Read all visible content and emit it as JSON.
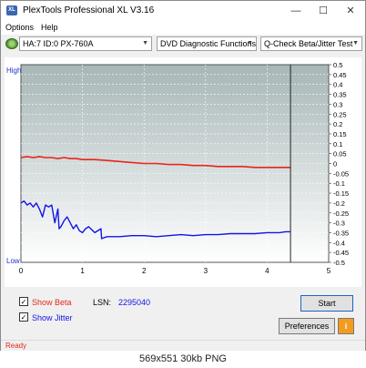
{
  "window": {
    "title": "PlexTools Professional XL V3.16",
    "icon_label": "XL",
    "min_glyph": "—",
    "max_glyph": "☐",
    "close_glyph": "✕"
  },
  "menu": {
    "options": "Options",
    "help": "Help"
  },
  "toolbar": {
    "drive": "HA:7 ID:0  PX-760A",
    "function": "DVD Diagnostic Functions",
    "test": "Q-Check Beta/Jitter Test"
  },
  "chart": {
    "high_label": "High",
    "low_label": "Low"
  },
  "chart_data": {
    "type": "line",
    "x_ticks": [
      "0",
      "1",
      "2",
      "3",
      "4",
      "5"
    ],
    "y_ticks": [
      "0.5",
      "0.45",
      "0.4",
      "0.35",
      "0.3",
      "0.25",
      "0.2",
      "0.15",
      "0.1",
      "0.05",
      "0",
      "-0.05",
      "-0.1",
      "-0.15",
      "-0.2",
      "-0.25",
      "-0.3",
      "-0.35",
      "-0.4",
      "-0.45",
      "-0.5"
    ],
    "xlim": [
      0,
      5
    ],
    "ylim": [
      -0.5,
      0.5
    ],
    "end_marker_x": 4.38,
    "grid": true,
    "series": [
      {
        "color": "#e8261c",
        "x": [
          0,
          0.1,
          0.2,
          0.3,
          0.4,
          0.5,
          0.6,
          0.7,
          0.8,
          0.9,
          1.0,
          1.2,
          1.4,
          1.6,
          1.8,
          2.0,
          2.2,
          2.4,
          2.6,
          2.8,
          3.0,
          3.2,
          3.4,
          3.6,
          3.8,
          4.0,
          4.2,
          4.38
        ],
        "y": [
          0.03,
          0.035,
          0.03,
          0.035,
          0.03,
          0.03,
          0.025,
          0.03,
          0.025,
          0.025,
          0.02,
          0.02,
          0.015,
          0.01,
          0.005,
          0.0,
          0.0,
          -0.005,
          -0.005,
          -0.01,
          -0.01,
          -0.015,
          -0.015,
          -0.015,
          -0.02,
          -0.02,
          -0.02,
          -0.02
        ]
      },
      {
        "color": "#1414e6",
        "x": [
          0,
          0.05,
          0.1,
          0.15,
          0.2,
          0.25,
          0.3,
          0.35,
          0.4,
          0.45,
          0.5,
          0.55,
          0.6,
          0.62,
          0.65,
          0.7,
          0.75,
          0.8,
          0.85,
          0.9,
          0.95,
          1.0,
          1.05,
          1.1,
          1.2,
          1.3,
          1.31,
          1.35,
          1.4,
          1.6,
          1.8,
          2.0,
          2.2,
          2.4,
          2.6,
          2.8,
          3.0,
          3.2,
          3.4,
          3.6,
          3.8,
          4.0,
          4.2,
          4.3,
          4.38
        ],
        "y": [
          -0.2,
          -0.19,
          -0.21,
          -0.2,
          -0.22,
          -0.2,
          -0.23,
          -0.27,
          -0.21,
          -0.22,
          -0.21,
          -0.3,
          -0.23,
          -0.33,
          -0.32,
          -0.29,
          -0.27,
          -0.3,
          -0.33,
          -0.31,
          -0.34,
          -0.35,
          -0.33,
          -0.32,
          -0.35,
          -0.33,
          -0.38,
          -0.375,
          -0.37,
          -0.37,
          -0.365,
          -0.365,
          -0.37,
          -0.365,
          -0.36,
          -0.365,
          -0.36,
          -0.36,
          -0.355,
          -0.355,
          -0.355,
          -0.35,
          -0.35,
          -0.345,
          -0.345
        ]
      }
    ]
  },
  "controls": {
    "show_beta": "Show Beta",
    "show_jitter": "Show Jitter",
    "lsn_label": "LSN:",
    "lsn_value": "2295040",
    "start": "Start",
    "preferences": "Preferences",
    "info_glyph": "i",
    "check_glyph": "✓",
    "beta_color": "#e8261c",
    "jitter_color": "#1414e6"
  },
  "status": {
    "text": "Ready",
    "color": "#e8261c"
  },
  "caption": "569x551  30kb  PNG"
}
